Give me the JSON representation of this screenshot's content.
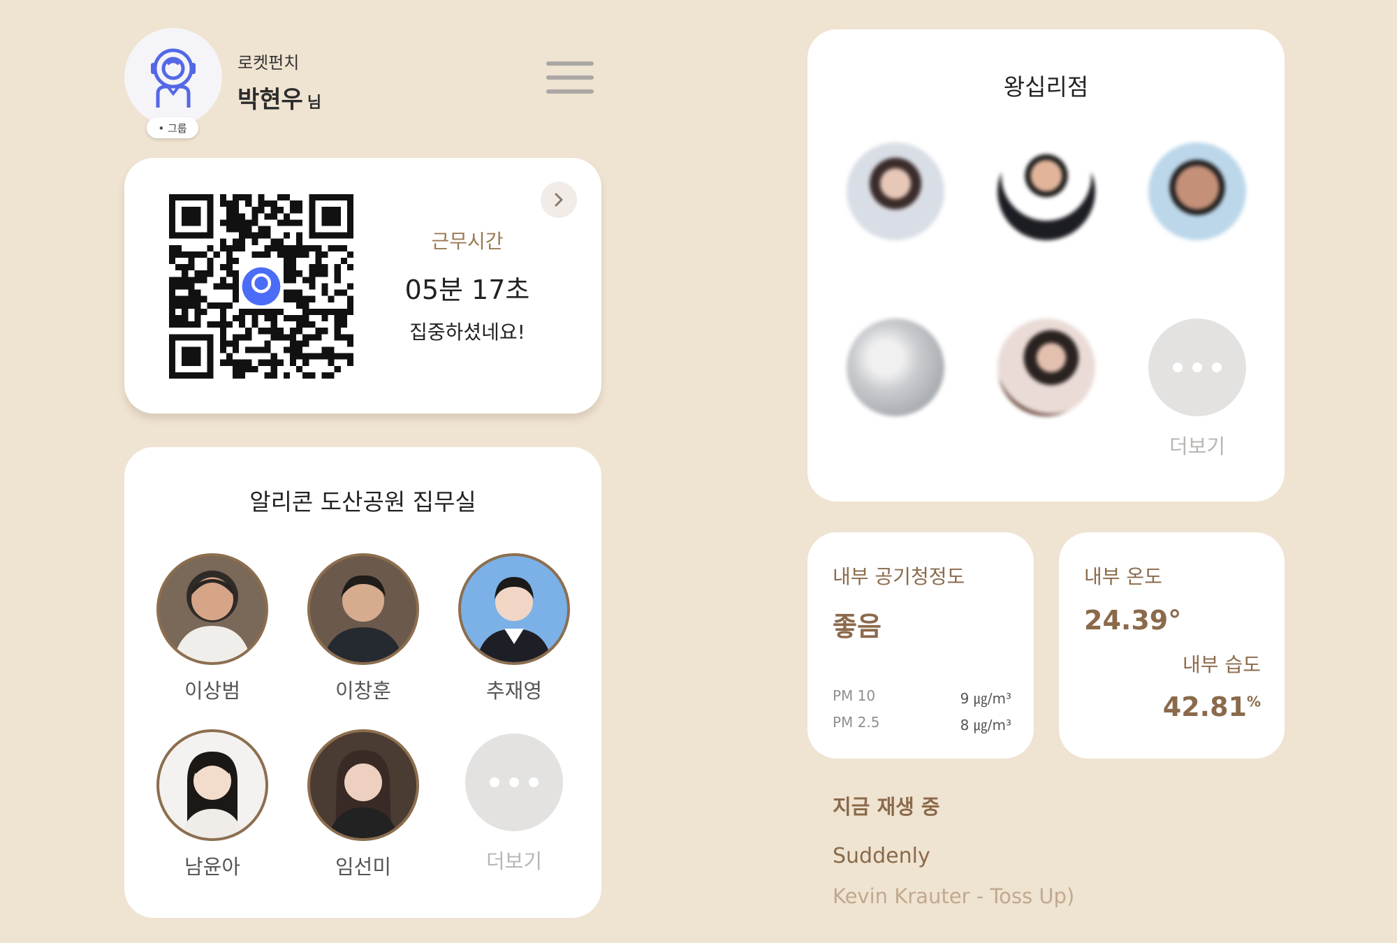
{
  "profile": {
    "company": "로켓펀치",
    "name": "박현우",
    "honorific": "님",
    "group_badge": "• 그룹"
  },
  "icons": {
    "avatar": "astronaut-icon",
    "menu": "hamburger-menu-icon",
    "detail": "chevron-right-icon",
    "more": "more-dots-icon"
  },
  "work": {
    "label": "근무시간",
    "time": "05분 17초",
    "message": "집중하셨네요!"
  },
  "office": {
    "title": "알리콘 도산공원 집무실",
    "members": [
      {
        "name": "이상범"
      },
      {
        "name": "이창훈"
      },
      {
        "name": "추재영"
      },
      {
        "name": "남윤아"
      },
      {
        "name": "임선미"
      }
    ],
    "more_label": "더보기"
  },
  "branch": {
    "title": "왕십리점",
    "more_label": "더보기"
  },
  "air": {
    "title": "내부 공기청정도",
    "status": "좋음",
    "pm10_label": "PM 10",
    "pm10_value": "9 ㎍/m³",
    "pm25_label": "PM 2.5",
    "pm25_value": "8 ㎍/m³"
  },
  "climate": {
    "temp_title": "내부 온도",
    "temp_value": "24.39°",
    "humidity_title": "내부 습도",
    "humidity_value": "42.81",
    "humidity_unit": "%"
  },
  "now_playing": {
    "title": "지금 재생 중",
    "song": "Suddenly",
    "artist": "Kevin Krauter - Toss Up)"
  },
  "colors": {
    "background": "#efe3d1",
    "accent_brown": "#8a6a4b",
    "qr_logo_blue": "#4a6cf7"
  }
}
